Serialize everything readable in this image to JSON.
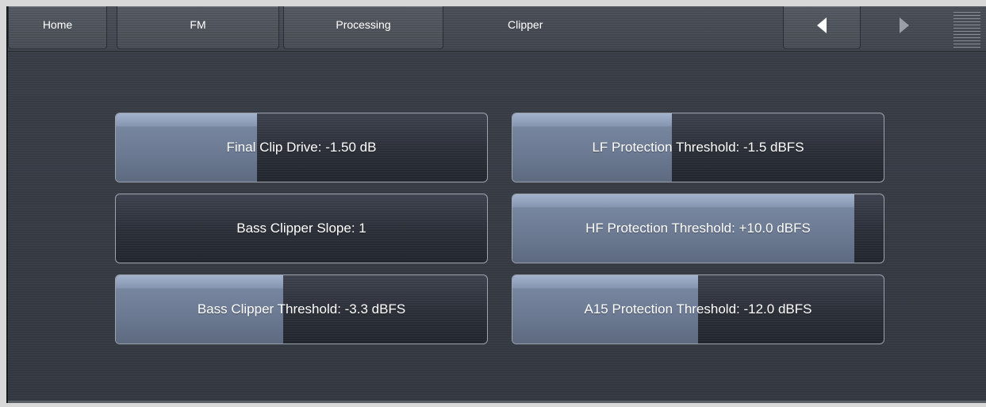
{
  "tabs": {
    "home": "Home",
    "fm": "FM",
    "processing": "Processing",
    "current": "Clipper"
  },
  "nav": {
    "back_icon": "arrow-left-icon",
    "forward_icon": "arrow-right-icon",
    "menu_icon": "menu-lines-icon"
  },
  "controls": [
    {
      "label": "Final Clip Drive: -1.50 dB",
      "level": 0.38
    },
    {
      "label": "LF Protection Threshold: -1.5 dBFS",
      "level": 0.43
    },
    {
      "label": "Bass Clipper Slope: 1",
      "level": 0.0
    },
    {
      "label": "HF Protection Threshold: +10.0 dBFS",
      "level": 0.92
    },
    {
      "label": "Bass Clipper Threshold: -3.3 dBFS",
      "level": 0.45
    },
    {
      "label": "A15 Protection Threshold: -12.0 dBFS",
      "level": 0.5
    }
  ],
  "colors": {
    "background": "#3a3f48",
    "fill": "#8797b2",
    "border": "#9da3ad",
    "text": "#ffffff"
  }
}
